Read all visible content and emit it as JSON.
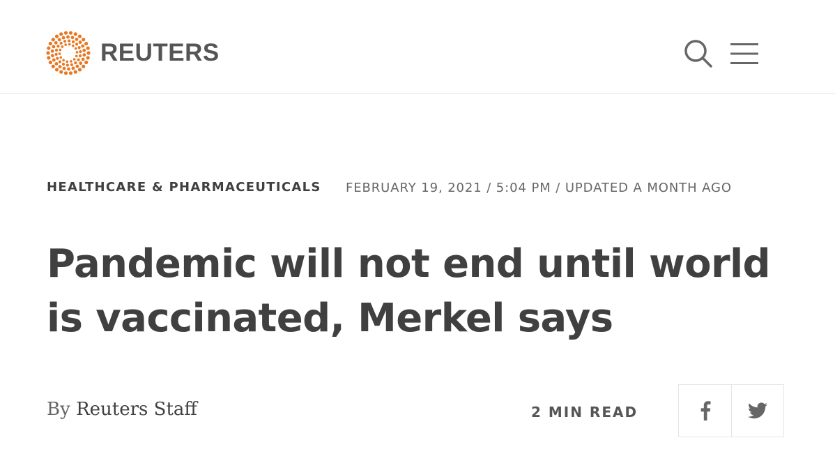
{
  "header": {
    "brand": "REUTERS",
    "logo_icon": "reuters-dot-circle-logo",
    "search_icon": "search-icon",
    "menu_icon": "hamburger-menu-icon",
    "accent_color": "#e87722"
  },
  "article": {
    "category": "HEALTHCARE & PHARMACEUTICALS",
    "dateline": "FEBRUARY 19, 2021 / 5:04 PM / UPDATED A MONTH AGO",
    "headline": "Pandemic will not end until world is vaccinated, Merkel says",
    "byline_prefix": "By",
    "author": "Reuters Staff",
    "read_time": "2 MIN READ"
  },
  "share": {
    "facebook_icon": "facebook-icon",
    "twitter_icon": "twitter-icon"
  }
}
